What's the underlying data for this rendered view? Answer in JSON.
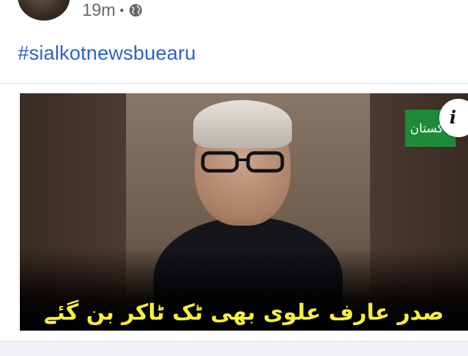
{
  "post": {
    "time": "19m",
    "separator": "•",
    "privacy_icon": "globe-icon",
    "hashtag": "#sialkotnewsbuearu"
  },
  "media": {
    "headline": "صدر عارف علوی بھی ٹک ٹاکر بن گئے",
    "logo_text": "پاکستان",
    "info_icon": "info-icon",
    "info_label": "i"
  },
  "colors": {
    "hashtag": "#2c63c9",
    "headline": "#f7ef3a",
    "logo": "#1f8b3a",
    "meta": "#65676b"
  }
}
